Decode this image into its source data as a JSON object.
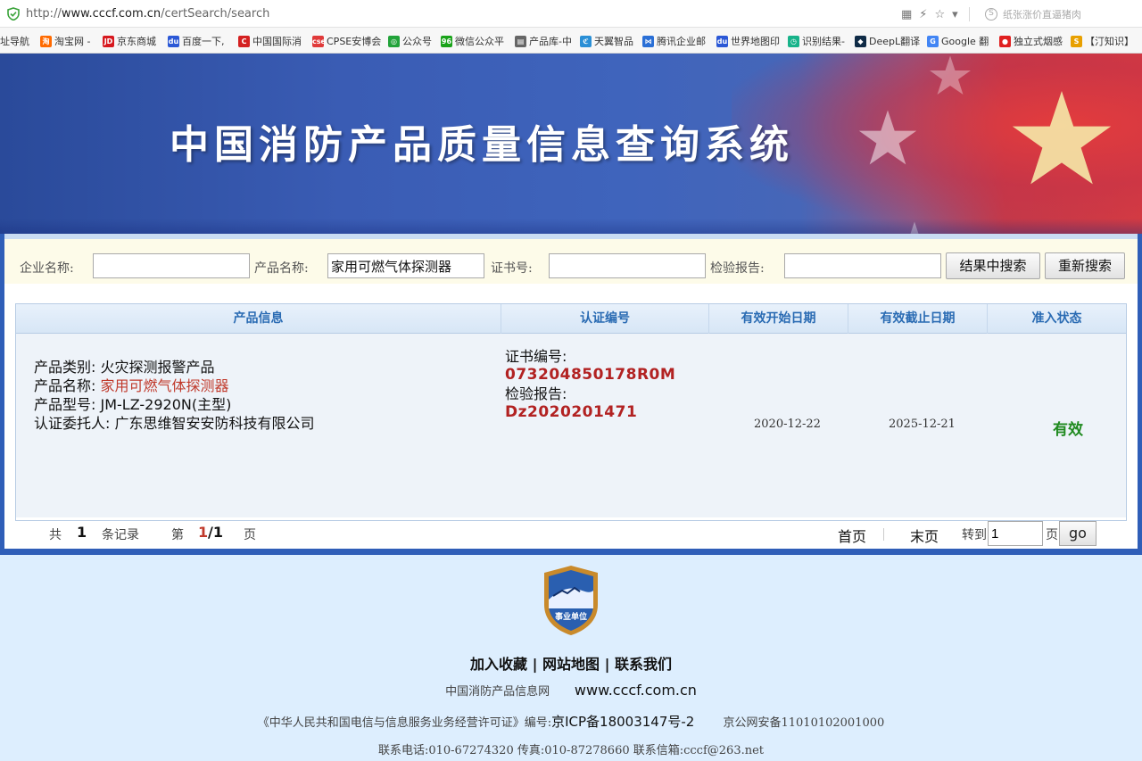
{
  "browser": {
    "url_prefix": "http://",
    "url_domain": "www.cccf.com.cn",
    "url_path": "/certSearch/search",
    "search_hint": "纸张涨价直逼猪肉"
  },
  "bookmarks": [
    {
      "label": "址导航",
      "icon": "",
      "color": "#f7f7f7"
    },
    {
      "label": "淘宝网 -",
      "icon": "淘",
      "color": "#ff6a00"
    },
    {
      "label": "京东商城",
      "icon": "JD",
      "color": "#d7191f"
    },
    {
      "label": "百度一下,",
      "icon": "du",
      "color": "#2b58d6"
    },
    {
      "label": "中国国际消",
      "icon": "C",
      "color": "#d42020"
    },
    {
      "label": "CPSE安博会",
      "icon": "cse",
      "color": "#e03a3a"
    },
    {
      "label": "公众号",
      "icon": "◎",
      "color": "#22a33a"
    },
    {
      "label": "微信公众平",
      "icon": "96",
      "color": "#1aa31a"
    },
    {
      "label": "产品库-中",
      "icon": "▤",
      "color": "#666666"
    },
    {
      "label": "天翼智品",
      "icon": "ℭ",
      "color": "#2a8fd6"
    },
    {
      "label": "腾讯企业邮",
      "icon": "⋈",
      "color": "#2a6fd6"
    },
    {
      "label": "世界地图印",
      "icon": "du",
      "color": "#2b58d6"
    },
    {
      "label": "识别结果-",
      "icon": "◷",
      "color": "#18b38a"
    },
    {
      "label": "DeepL翻译",
      "icon": "◆",
      "color": "#0f2b46"
    },
    {
      "label": "Google 翻",
      "icon": "G",
      "color": "#4285f4"
    },
    {
      "label": "独立式烟感",
      "icon": "●",
      "color": "#e02020"
    },
    {
      "label": "【汀知识】",
      "icon": "S",
      "color": "#e8a000"
    }
  ],
  "banner": {
    "title": "中国消防产品质量信息查询系统"
  },
  "search": {
    "company_label": "企业名称:",
    "company_value": "",
    "product_label": "产品名称:",
    "product_value": "家用可燃气体探测器",
    "cert_label": "证书号:",
    "cert_value": "",
    "report_label": "检验报告:",
    "report_value": "",
    "search_in_results": "结果中搜索",
    "new_search": "重新搜索"
  },
  "table": {
    "headers": [
      "产品信息",
      "认证编号",
      "有效开始日期",
      "有效截止日期",
      "准入状态"
    ],
    "row": {
      "category_label": "产品类别:",
      "category_value": "火灾探测报警产品",
      "name_label": "产品名称:",
      "name_value": "家用可燃气体探测器",
      "model_label": "产品型号:",
      "model_value": "JM-LZ-2920N(主型)",
      "client_label": "认证委托人:",
      "client_value": "广东思维智安安防科技有限公司",
      "cert_no_label": "证书编号:",
      "cert_no_value": "073204850178R0M",
      "report_label": "检验报告:",
      "report_value": "Dz2020201471",
      "start_date": "2020-12-22",
      "end_date": "2025-12-21",
      "status": "有效"
    }
  },
  "pager": {
    "total_prefix": "共",
    "total_count": "1",
    "total_suffix": "条记录",
    "page_prefix": "第",
    "page_current": "1",
    "page_total": "/1",
    "page_suffix": "页",
    "first": "首页",
    "last": "末页",
    "goto_label": "转到",
    "goto_value": "1",
    "goto_suffix": "页",
    "go": "go"
  },
  "footer": {
    "badge_text": "事业单位",
    "links": [
      "加入收藏",
      "网站地图",
      "联系我们"
    ],
    "link_sep": "|",
    "site_name": "中国消防产品信息网",
    "site_url": "www.cccf.com.cn",
    "license_text": "《中华人民共和国电信与信息服务业务经营许可证》编号:",
    "icp": "京ICP备18003147号-2",
    "gongan": "京公网安备11010102001000",
    "contact": "联系电话:010-67274320 传真:010-87278660 联系信箱:cccf@263.net"
  }
}
